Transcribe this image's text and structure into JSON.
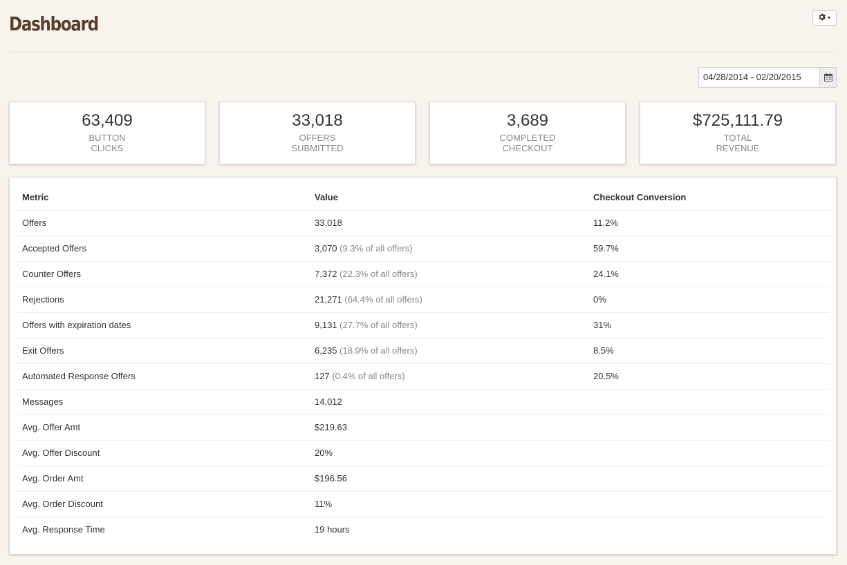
{
  "header": {
    "title": "Dashboard"
  },
  "date_range": {
    "value": "04/28/2014 - 02/20/2015"
  },
  "cards": [
    {
      "value": "63,409",
      "label": "BUTTON\nCLICKS"
    },
    {
      "value": "33,018",
      "label": "OFFERS\nSUBMITTED"
    },
    {
      "value": "3,689",
      "label": "COMPLETED\nCHECKOUT"
    },
    {
      "value": "$725,111.79",
      "label": "TOTAL\nREVENUE"
    }
  ],
  "table": {
    "headers": [
      "Metric",
      "Value",
      "Checkout Conversion"
    ],
    "rows": [
      {
        "metric": "Offers",
        "value": "33,018",
        "note": "",
        "conversion": "11.2%"
      },
      {
        "metric": "Accepted Offers",
        "value": "3,070",
        "note": "(9.3% of all offers)",
        "conversion": "59.7%"
      },
      {
        "metric": "Counter Offers",
        "value": "7,372",
        "note": "(22.3% of all offers)",
        "conversion": "24.1%"
      },
      {
        "metric": "Rejections",
        "value": "21,271",
        "note": "(64.4% of all offers)",
        "conversion": "0%"
      },
      {
        "metric": "Offers with expiration dates",
        "value": "9,131",
        "note": "(27.7% of all offers)",
        "conversion": "31%"
      },
      {
        "metric": "Exit Offers",
        "value": "6,235",
        "note": "(18.9% of all offers)",
        "conversion": "8.5%"
      },
      {
        "metric": "Automated Response Offers",
        "value": "127",
        "note": "(0.4% of all offers)",
        "conversion": "20.5%"
      },
      {
        "metric": "Messages",
        "value": "14,012",
        "note": "",
        "conversion": ""
      },
      {
        "metric": "Avg. Offer Amt",
        "value": "$219.63",
        "note": "",
        "conversion": ""
      },
      {
        "metric": "Avg. Offer Discount",
        "value": "20%",
        "note": "",
        "conversion": ""
      },
      {
        "metric": "Avg. Order Amt",
        "value": "$196.56",
        "note": "",
        "conversion": ""
      },
      {
        "metric": "Avg. Order Discount",
        "value": "11%",
        "note": "",
        "conversion": ""
      },
      {
        "metric": "Avg. Response Time",
        "value": "19 hours",
        "note": "",
        "conversion": ""
      }
    ]
  }
}
